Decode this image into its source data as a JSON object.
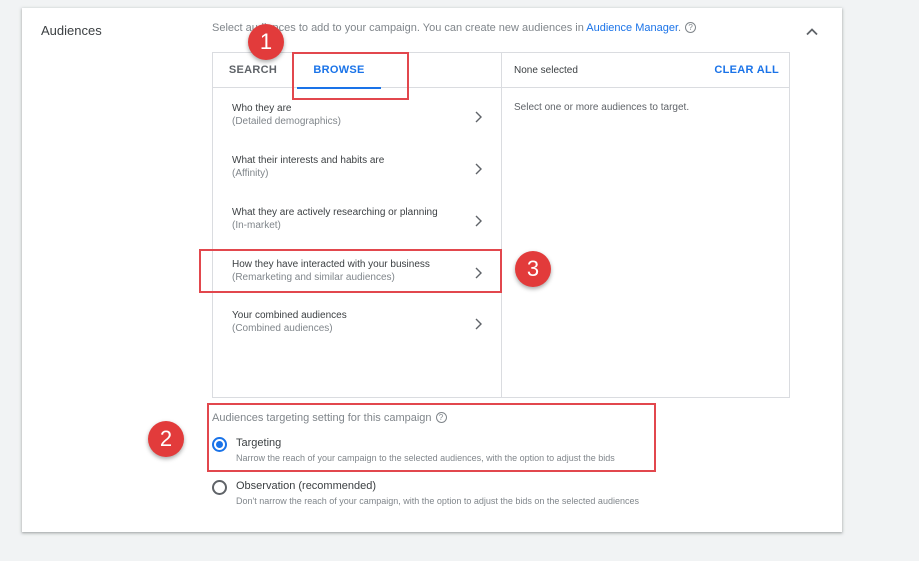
{
  "section": {
    "title": "Audiences",
    "description_prefix": "Select audiences to add to your campaign. You can create new audiences in ",
    "description_link": "Audience Manager",
    "description_suffix": ".",
    "help_glyph": "?"
  },
  "tabs": [
    {
      "label": "SEARCH",
      "active": false
    },
    {
      "label": "BROWSE",
      "active": true
    }
  ],
  "categories": [
    {
      "title": "Who they are",
      "subtitle": "(Detailed demographics)"
    },
    {
      "title": "What their interests and habits are",
      "subtitle": "(Affinity)"
    },
    {
      "title": "What they are actively researching or planning",
      "subtitle": "(In-market)"
    },
    {
      "title": "How they have interacted with your business",
      "subtitle": "(Remarketing and similar audiences)"
    },
    {
      "title": "Your combined audiences",
      "subtitle": "(Combined audiences)"
    }
  ],
  "selection": {
    "status": "None selected",
    "clear_all": "CLEAR ALL",
    "hint": "Select one or more audiences to target."
  },
  "targeting_setting": {
    "label": "Audiences targeting setting for this campaign",
    "options": [
      {
        "title": "Targeting",
        "description": "Narrow the reach of your campaign to the selected audiences, with the option to adjust the bids",
        "selected": true
      },
      {
        "title": "Observation (recommended)",
        "description": "Don't narrow the reach of your campaign, with the option to adjust the bids on the selected audiences",
        "selected": false
      }
    ]
  },
  "annotations": [
    {
      "number": "1"
    },
    {
      "number": "2"
    },
    {
      "number": "3"
    }
  ],
  "colors": {
    "accent": "#1a73e8",
    "annotation_red": "#e23b3b",
    "page_bg": "#f1f3f4"
  },
  "icons": {
    "collapse": "chevron-up-icon",
    "category_arrow": "chevron-right-icon",
    "help": "help-circle-icon"
  }
}
